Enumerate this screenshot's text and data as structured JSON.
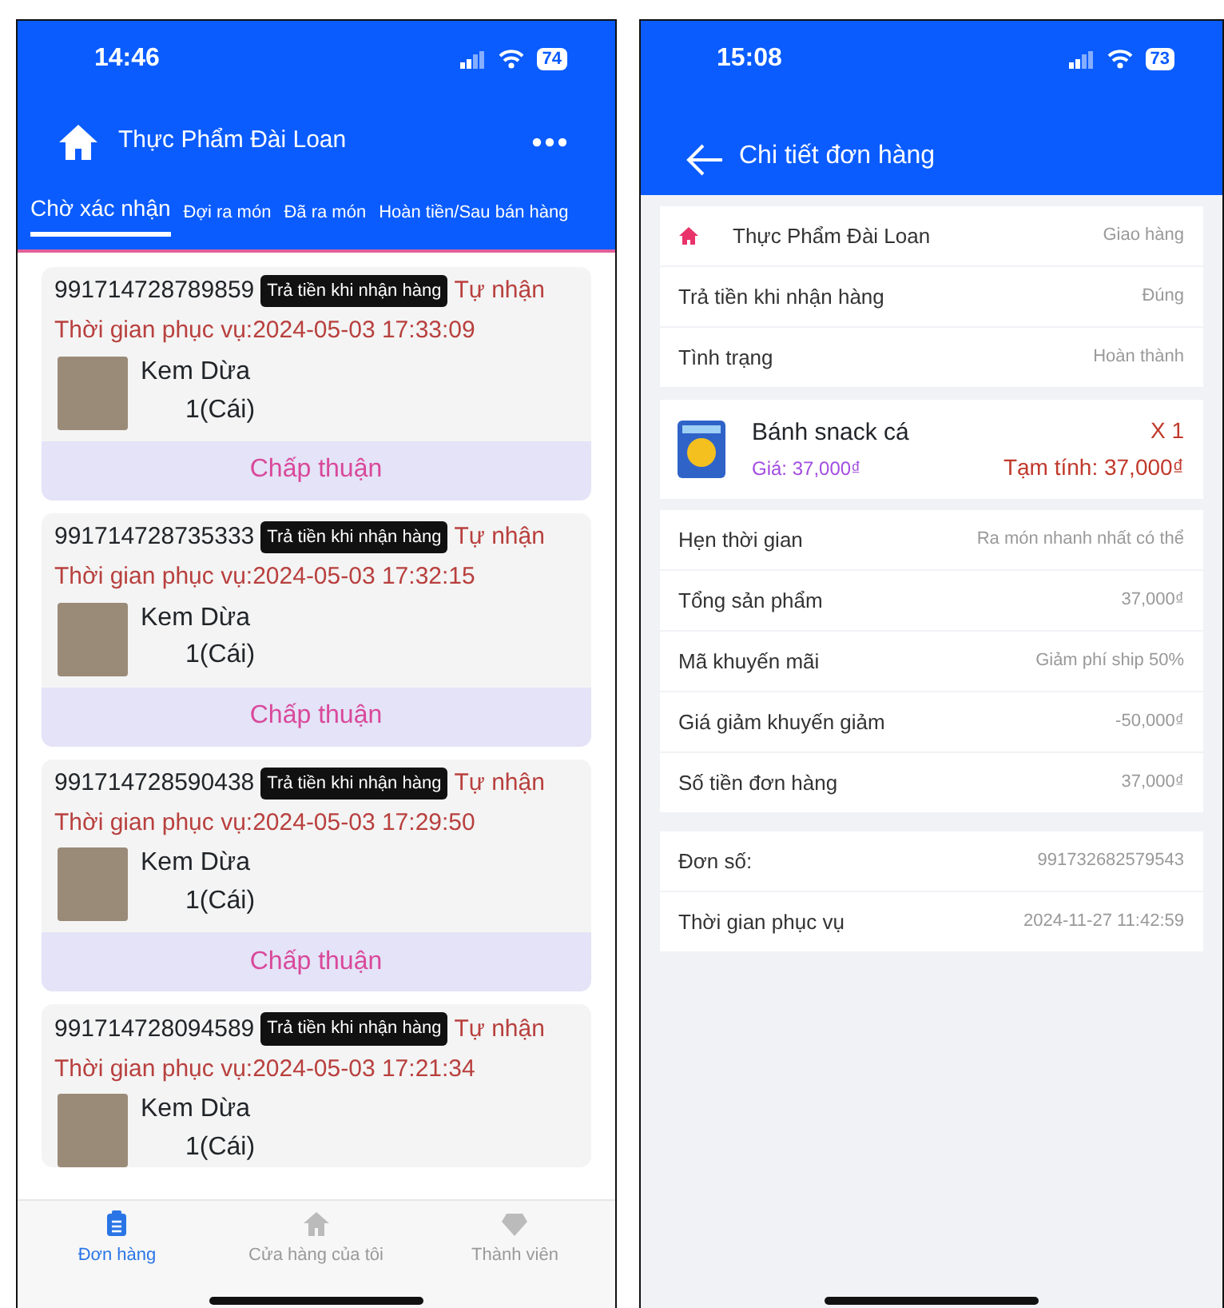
{
  "order_list_screen": {
    "status_bar": {
      "time": "14:46",
      "battery": "74"
    },
    "header": {
      "title": "Thực Phẩm Đài Loan"
    },
    "tabs": [
      {
        "label": "Chờ xác nhận",
        "selected": true
      },
      {
        "label": "Đợi ra món",
        "selected": false
      },
      {
        "label": "Đã ra món",
        "selected": false
      },
      {
        "label": "Hoàn tiền/Sau bán hàng",
        "selected": false
      }
    ],
    "orders": [
      {
        "order_no": "991714728789859",
        "payment_tag": "Trả tiền khi nhận hàng",
        "delivery": "Tự nhận",
        "service_time": "Thời gian phục vụ:2024-05-03 17:33:09",
        "item_name": "Kem Dừa",
        "item_qty": "1(Cái)",
        "action": "Chấp thuận"
      },
      {
        "order_no": "991714728735333",
        "payment_tag": "Trả tiền khi nhận hàng",
        "delivery": "Tự nhận",
        "service_time": "Thời gian phục vụ:2024-05-03 17:32:15",
        "item_name": "Kem Dừa",
        "item_qty": "1(Cái)",
        "action": "Chấp thuận"
      },
      {
        "order_no": "991714728590438",
        "payment_tag": "Trả tiền khi nhận hàng",
        "delivery": "Tự nhận",
        "service_time": "Thời gian phục vụ:2024-05-03 17:29:50",
        "item_name": "Kem Dừa",
        "item_qty": "1(Cái)",
        "action": "Chấp thuận"
      },
      {
        "order_no": "991714728094589",
        "payment_tag": "Trả tiền khi nhận hàng",
        "delivery": "Tự nhận",
        "service_time": "Thời gian phục vụ:2024-05-03 17:21:34",
        "item_name": "Kem Dừa",
        "item_qty": "1(Cái)"
      }
    ],
    "bottom_nav": [
      {
        "label": "Đơn hàng",
        "kind": "orders",
        "selected": true
      },
      {
        "label": "Cửa hàng của tôi",
        "kind": "store",
        "selected": false
      },
      {
        "label": "Thành viên",
        "kind": "member",
        "selected": false
      }
    ]
  },
  "order_detail_screen": {
    "status_bar": {
      "time": "15:08",
      "battery": "73"
    },
    "header": {
      "title": "Chi tiết đơn hàng"
    },
    "info_rows": [
      {
        "kind": "store",
        "label": "Thực Phẩm Đài Loan",
        "value": "Giao hàng"
      },
      {
        "kind": "plain",
        "label": "Trả tiền khi nhận hàng",
        "value": "Đúng"
      },
      {
        "kind": "plain",
        "label": "Tình trạng",
        "value": "Hoàn thành"
      }
    ],
    "product": {
      "name": "Bánh snack cá",
      "price": "Giá: 37,000₫",
      "quantity": "X 1",
      "subtotal": "Tạm tính: 37,000₫"
    },
    "summary_rows": [
      {
        "label": "Hẹn thời gian",
        "value": "Ra món nhanh nhất có thể"
      },
      {
        "label": "Tổng sản phẩm",
        "value": "37,000₫"
      },
      {
        "label": "Mã khuyến mãi",
        "value": "Giảm phí ship 50%"
      },
      {
        "label": "Giá giảm khuyến giảm",
        "value": "-50,000₫"
      },
      {
        "label": "Số tiền đơn hàng",
        "value": "37,000₫"
      }
    ],
    "order_rows": [
      {
        "label": "Đơn số:",
        "value": "991732682579543"
      },
      {
        "label": "Thời gian phục vụ",
        "value": "2024-11-27 11:42:59"
      }
    ]
  }
}
